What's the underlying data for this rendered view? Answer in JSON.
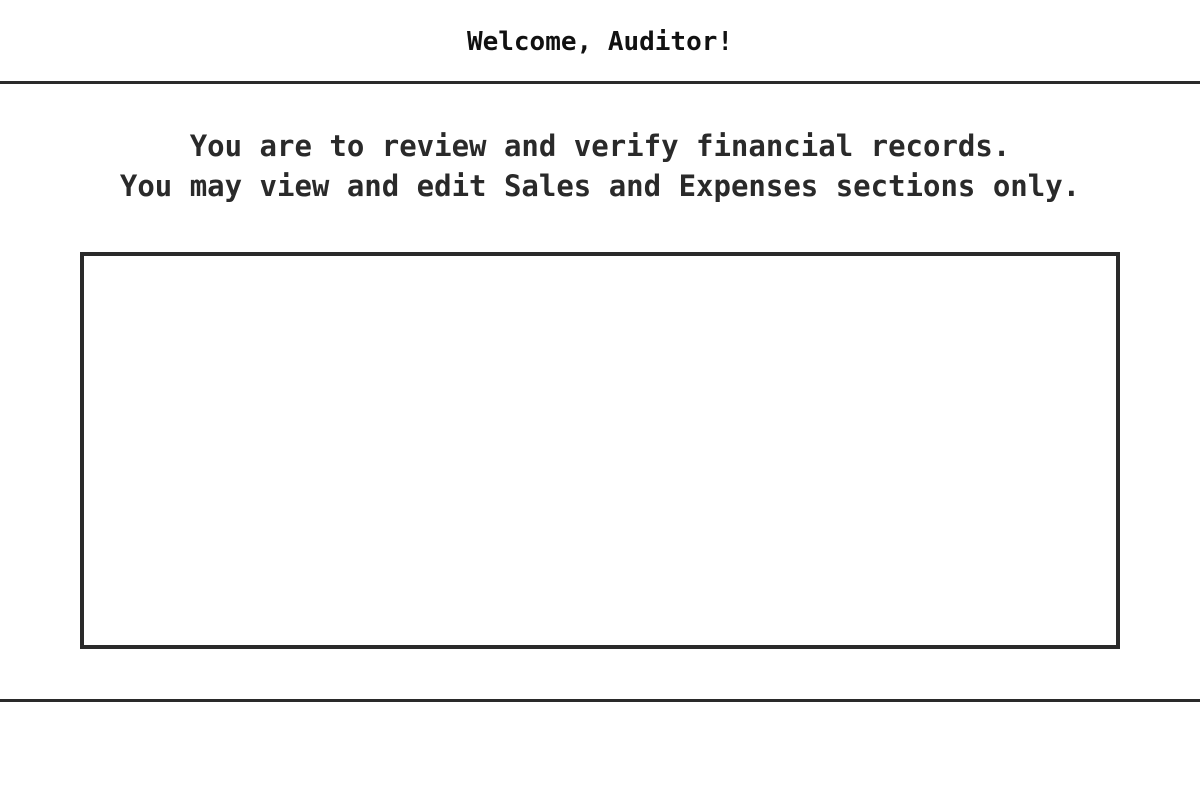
{
  "header": {
    "welcome_text": "Welcome, Auditor!"
  },
  "instructions": {
    "line1": "You are to review and verify financial records.",
    "line2": "You may view and edit Sales and Expenses sections only."
  },
  "colors": {
    "text": "#2a2a2a",
    "border": "#2a2a2a",
    "background": "#ffffff"
  }
}
